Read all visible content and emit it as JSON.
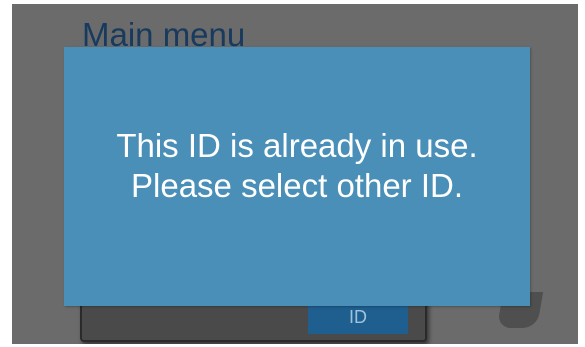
{
  "header": {
    "title": "Main menu"
  },
  "background": {
    "id_button_label": "ID"
  },
  "dialog": {
    "message_line1": "This ID is already in use.",
    "message_line2": "Please select other ID."
  },
  "colors": {
    "screen_bg": "#6b6b6b",
    "dialog_bg": "#4a8fb8",
    "title_color": "#173a5e",
    "id_button_bg": "#1f5f8f"
  }
}
